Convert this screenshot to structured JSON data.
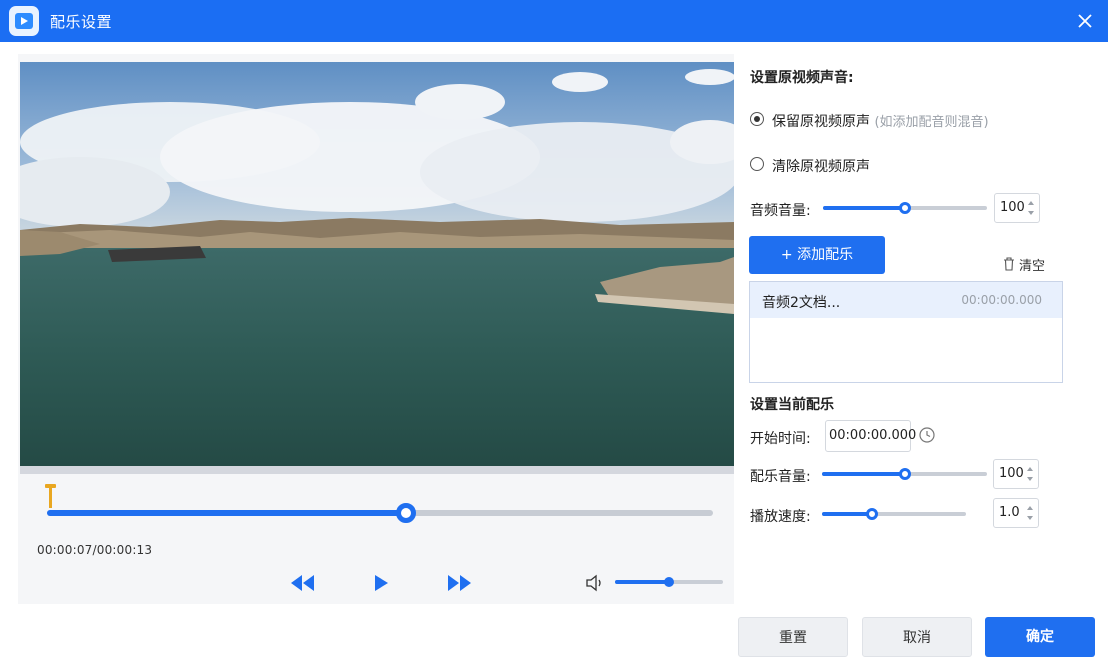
{
  "window": {
    "title": "配乐设置",
    "close_icon": "close-icon"
  },
  "player": {
    "time_display": "00:00:07/00:00:13",
    "current_seconds": 7,
    "total_seconds": 13,
    "preview_volume_fraction": 0.5
  },
  "original_audio": {
    "section_title": "设置原视频声音:",
    "options": [
      {
        "label": "保留原视频原声",
        "hint": "(如添加配音则混音)",
        "selected": true
      },
      {
        "label": "清除原视频原声",
        "hint": "",
        "selected": false
      }
    ],
    "volume_label": "音频音量:",
    "volume_value": "100",
    "volume_fraction": 0.5
  },
  "music": {
    "add_button_label": "+ 添加配乐",
    "clear_label": "清空",
    "items": [
      {
        "name": "音频2文档...",
        "time": "00:00:00.000"
      }
    ]
  },
  "current_music": {
    "section_title": "设置当前配乐",
    "start_time_label": "开始时间:",
    "start_time_value": "00:00:00.000",
    "volume_label": "配乐音量:",
    "volume_value": "100",
    "volume_fraction": 0.5,
    "speed_label": "播放速度:",
    "speed_value": "1.0",
    "speed_fraction": 0.35
  },
  "footer": {
    "reset_label": "重置",
    "cancel_label": "取消",
    "ok_label": "确定"
  },
  "colors": {
    "accent": "#1f6ff0",
    "titlebar": "#1b6ef3",
    "trim_marker": "#e9a721"
  }
}
